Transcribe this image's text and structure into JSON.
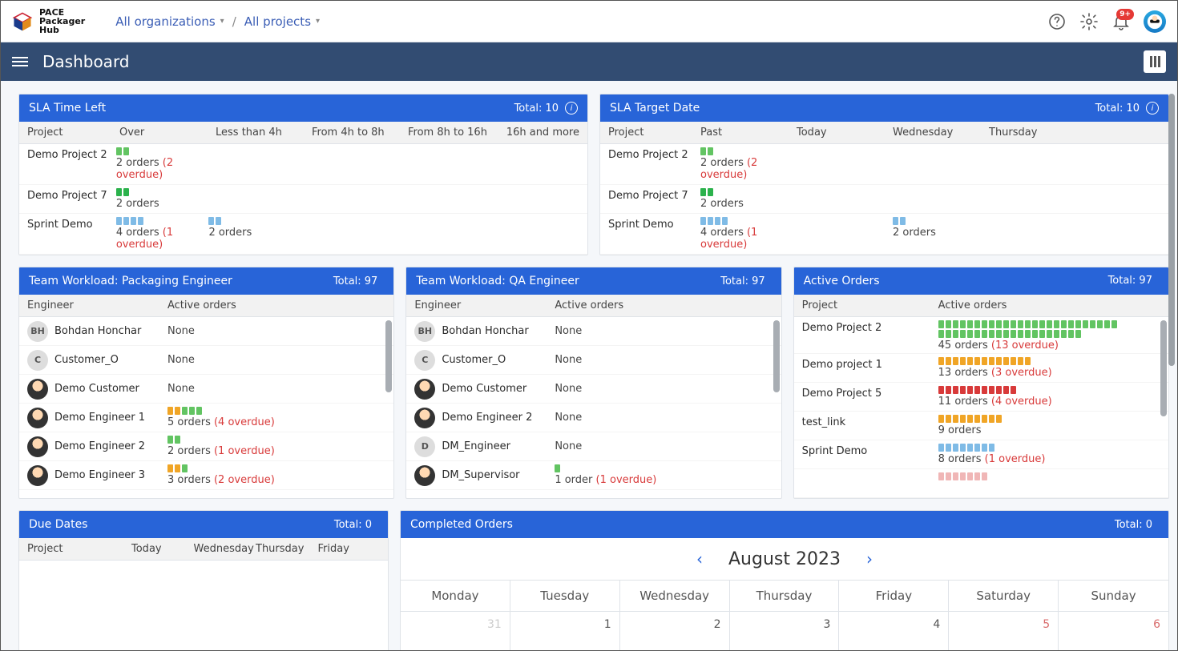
{
  "app": {
    "logo_lines": [
      "PACE",
      "Packager",
      "Hub"
    ],
    "crumbs": {
      "org": "All organizations",
      "proj": "All projects"
    },
    "notif_badge": "9+"
  },
  "page": {
    "title": "Dashboard"
  },
  "sla_time": {
    "title": "SLA Time Left",
    "total": "Total: 10",
    "headers": [
      "Project",
      "Over",
      "Less than 4h",
      "From 4h to 8h",
      "From 8h to 16h",
      "16h and more"
    ],
    "rows": [
      {
        "project": "Demo Project 2",
        "cells": [
          {
            "colors": [
              "green",
              "green"
            ],
            "text": "2 orders ",
            "over": "(2 overdue)"
          },
          {},
          {},
          {},
          {}
        ]
      },
      {
        "project": "Demo Project 7",
        "cells": [
          {
            "colors": [
              "green2",
              "green2"
            ],
            "text": "2 orders"
          },
          {},
          {},
          {},
          {}
        ]
      },
      {
        "project": "Sprint Demo",
        "cells": [
          {
            "colors": [
              "blue",
              "blue",
              "blue",
              "blue"
            ],
            "text": "4 orders ",
            "over": "(1 overdue)"
          },
          {
            "colors": [
              "blue",
              "blue"
            ],
            "text": "2 orders"
          },
          {},
          {},
          {}
        ]
      }
    ]
  },
  "sla_date": {
    "title": "SLA Target Date",
    "total": "Total: 10",
    "headers": [
      "Project",
      "Past",
      "Today",
      "Wednesday",
      "Thursday"
    ],
    "rows": [
      {
        "project": "Demo Project 2",
        "cells": [
          {
            "colors": [
              "green",
              "green"
            ],
            "text": "2 orders ",
            "over": "(2 overdue)"
          },
          {},
          {},
          {}
        ]
      },
      {
        "project": "Demo Project 7",
        "cells": [
          {
            "colors": [
              "green2",
              "green2"
            ],
            "text": "2 orders"
          },
          {},
          {},
          {}
        ]
      },
      {
        "project": "Sprint Demo",
        "cells": [
          {
            "colors": [
              "blue",
              "blue",
              "blue",
              "blue"
            ],
            "text": "4 orders ",
            "over": "(1 overdue)"
          },
          {},
          {
            "colors": [
              "blue",
              "blue"
            ],
            "text": "2 orders"
          },
          {}
        ]
      }
    ]
  },
  "wl_pkg": {
    "title": "Team Workload: Packaging Engineer",
    "total": "Total: 97",
    "headers": [
      "Engineer",
      "Active orders"
    ],
    "rows": [
      {
        "av": "BH",
        "name": "Bohdan Honchar",
        "text": "None"
      },
      {
        "av": "C",
        "name": "Customer_O",
        "text": "None"
      },
      {
        "av": "img",
        "name": "Demo Customer",
        "text": "None"
      },
      {
        "av": "img",
        "name": "Demo Engineer 1",
        "colors": [
          "orange",
          "orange",
          "green",
          "green",
          "green"
        ],
        "text": "5 orders ",
        "over": "(4 overdue)"
      },
      {
        "av": "img",
        "name": "Demo Engineer 2",
        "colors": [
          "green",
          "green"
        ],
        "text": "2 orders ",
        "over": "(1 overdue)"
      },
      {
        "av": "img",
        "name": "Demo Engineer 3",
        "colors": [
          "orange",
          "orange",
          "green"
        ],
        "text": "3 orders ",
        "over": "(2 overdue)"
      }
    ]
  },
  "wl_qa": {
    "title": "Team Workload: QA Engineer",
    "total": "Total: 97",
    "headers": [
      "Engineer",
      "Active orders"
    ],
    "rows": [
      {
        "av": "BH",
        "name": "Bohdan Honchar",
        "text": "None"
      },
      {
        "av": "C",
        "name": "Customer_O",
        "text": "None"
      },
      {
        "av": "img",
        "name": "Demo Customer",
        "text": "None"
      },
      {
        "av": "img",
        "name": "Demo Engineer 2",
        "text": "None"
      },
      {
        "av": "D",
        "name": "DM_Engineer",
        "text": "None"
      },
      {
        "av": "img",
        "name": "DM_Supervisor",
        "colors": [
          "green"
        ],
        "text": "1 order ",
        "over": "(1 overdue)"
      }
    ]
  },
  "active": {
    "title": "Active Orders",
    "total": "Total: 97",
    "headers": [
      "Project",
      "Active orders"
    ],
    "rows": [
      {
        "project": "Demo Project 2",
        "colors_n": 45,
        "color": "green",
        "text": "45 orders ",
        "over": "(13 overdue)"
      },
      {
        "project": "Demo project 1",
        "colors_n": 13,
        "color": "orange",
        "text": "13 orders ",
        "over": "(3 overdue)"
      },
      {
        "project": "Demo Project 5",
        "colors_n": 11,
        "color": "red",
        "text": "11 orders ",
        "over": "(4 overdue)"
      },
      {
        "project": "test_link",
        "colors_n": 9,
        "color": "orange",
        "text": "9 orders"
      },
      {
        "project": "Sprint Demo",
        "colors_n": 8,
        "color": "blue",
        "text": "8 orders ",
        "over": "(1 overdue)"
      },
      {
        "project": "",
        "colors_n": 7,
        "color": "pink",
        "text": ""
      }
    ]
  },
  "due": {
    "title": "Due Dates",
    "total": "Total: 0",
    "headers": [
      "Project",
      "Today",
      "Wednesday",
      "Thursday",
      "Friday"
    ]
  },
  "completed": {
    "title": "Completed Orders",
    "total": "Total: 0",
    "month": "August 2023",
    "day_headers": [
      "Monday",
      "Tuesday",
      "Wednesday",
      "Thursday",
      "Friday",
      "Saturday",
      "Sunday"
    ],
    "week1": [
      {
        "n": "31",
        "grey": true
      },
      {
        "n": "1"
      },
      {
        "n": "2"
      },
      {
        "n": "3"
      },
      {
        "n": "4"
      },
      {
        "n": "5",
        "we": true
      },
      {
        "n": "6",
        "we": true
      }
    ]
  }
}
